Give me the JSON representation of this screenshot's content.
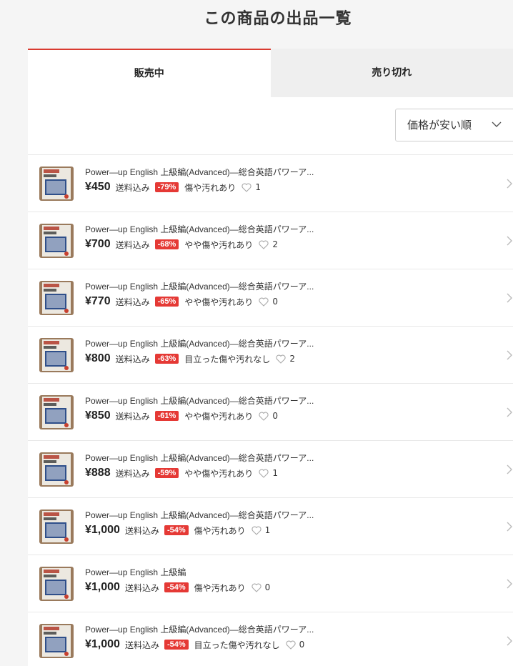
{
  "page": {
    "title": "この商品の出品一覧"
  },
  "tabs": [
    {
      "label": "販売中",
      "active": true
    },
    {
      "label": "売り切れ",
      "active": false
    }
  ],
  "sort": {
    "selected": "価格が安い順"
  },
  "colors": {
    "accent": "#d93b30",
    "discount_badge": "#e53935"
  },
  "items": [
    {
      "title": "Power—up English 上級編(Advanced)—総合英語パワーア...",
      "price": "¥450",
      "shipping": "送料込み",
      "discount": "-79%",
      "condition": "傷や汚れあり",
      "likes": "1"
    },
    {
      "title": "Power—up English 上級編(Advanced)—総合英語パワーア...",
      "price": "¥700",
      "shipping": "送料込み",
      "discount": "-68%",
      "condition": "やや傷や汚れあり",
      "likes": "2"
    },
    {
      "title": "Power—up English 上級編(Advanced)—総合英語パワーア...",
      "price": "¥770",
      "shipping": "送料込み",
      "discount": "-65%",
      "condition": "やや傷や汚れあり",
      "likes": "0"
    },
    {
      "title": "Power—up English 上級編(Advanced)—総合英語パワーア...",
      "price": "¥800",
      "shipping": "送料込み",
      "discount": "-63%",
      "condition": "目立った傷や汚れなし",
      "likes": "2"
    },
    {
      "title": "Power—up English 上級編(Advanced)—総合英語パワーア...",
      "price": "¥850",
      "shipping": "送料込み",
      "discount": "-61%",
      "condition": "やや傷や汚れあり",
      "likes": "0"
    },
    {
      "title": "Power—up English 上級編(Advanced)—総合英語パワーア...",
      "price": "¥888",
      "shipping": "送料込み",
      "discount": "-59%",
      "condition": "やや傷や汚れあり",
      "likes": "1"
    },
    {
      "title": "Power—up English 上級編(Advanced)—総合英語パワーア...",
      "price": "¥1,000",
      "shipping": "送料込み",
      "discount": "-54%",
      "condition": "傷や汚れあり",
      "likes": "1"
    },
    {
      "title": "Power—up English 上級編",
      "price": "¥1,000",
      "shipping": "送料込み",
      "discount": "-54%",
      "condition": "傷や汚れあり",
      "likes": "0"
    },
    {
      "title": "Power—up English 上級編(Advanced)—総合英語パワーア...",
      "price": "¥1,000",
      "shipping": "送料込み",
      "discount": "-54%",
      "condition": "目立った傷や汚れなし",
      "likes": "0"
    }
  ]
}
